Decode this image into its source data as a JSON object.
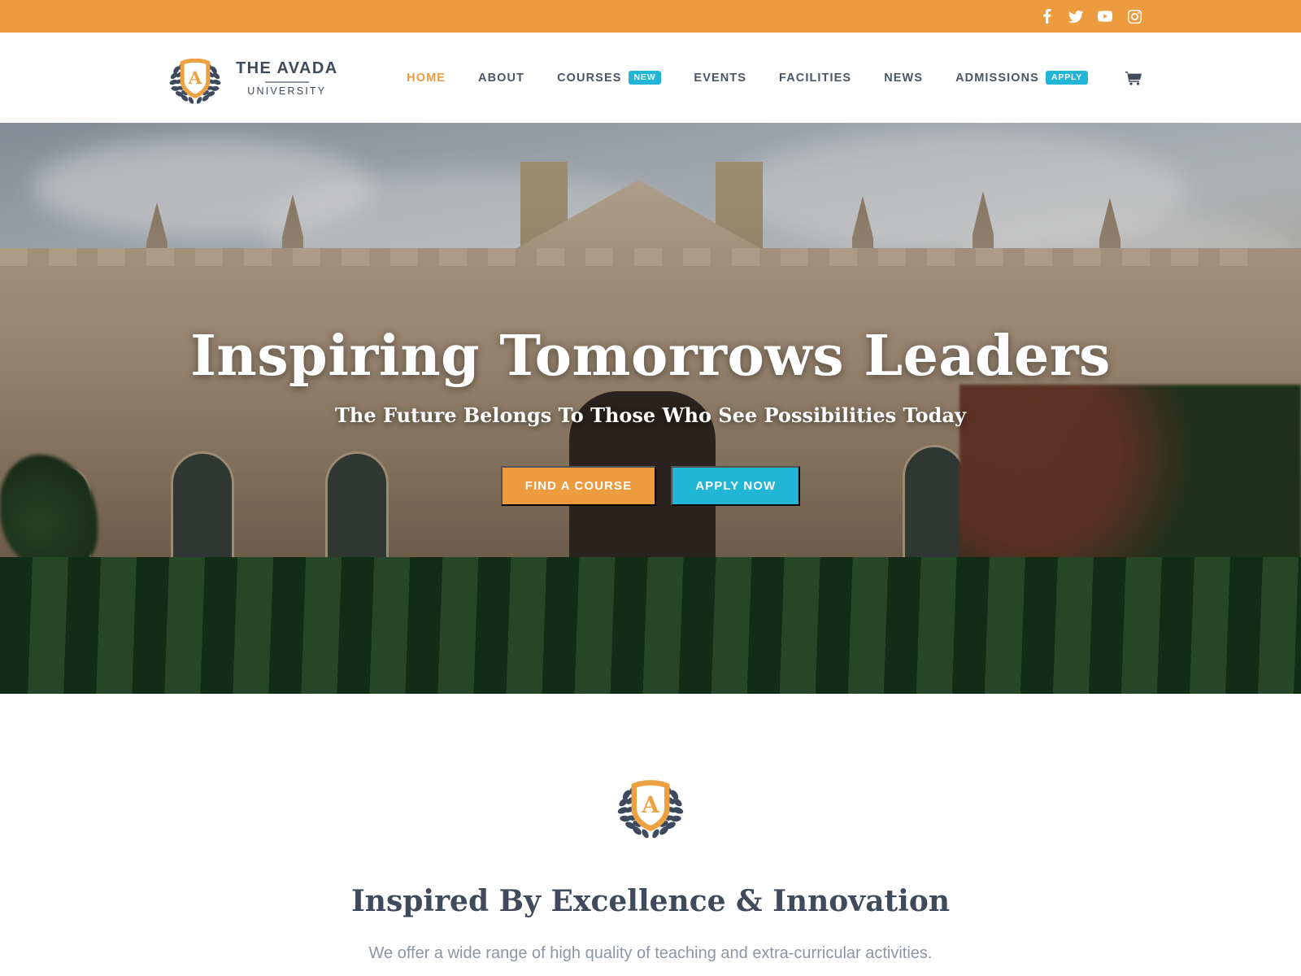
{
  "topbar": {
    "background": "#ed9b3f",
    "social": [
      {
        "name": "facebook-icon",
        "label": "Facebook"
      },
      {
        "name": "twitter-icon",
        "label": "Twitter"
      },
      {
        "name": "youtube-icon",
        "label": "YouTube"
      },
      {
        "name": "instagram-icon",
        "label": "Instagram"
      }
    ]
  },
  "header": {
    "logo": {
      "title": "THE AVADA",
      "subtitle": "UNIVERSITY",
      "mark": "laurel-shield-a-emblem"
    },
    "nav": [
      {
        "label": "HOME",
        "active": true,
        "badge": null
      },
      {
        "label": "ABOUT",
        "active": false,
        "badge": null
      },
      {
        "label": "COURSES",
        "active": false,
        "badge": "NEW"
      },
      {
        "label": "EVENTS",
        "active": false,
        "badge": null
      },
      {
        "label": "FACILITIES",
        "active": false,
        "badge": null
      },
      {
        "label": "NEWS",
        "active": false,
        "badge": null
      },
      {
        "label": "ADMISSIONS",
        "active": false,
        "badge": "APPLY"
      }
    ],
    "cart": {
      "name": "shopping-cart-icon"
    }
  },
  "hero": {
    "title": "Inspiring Tomorrows Leaders",
    "subtitle": "The Future Belongs To Those Who See Possibilities Today",
    "buttons": [
      {
        "label": "FIND A COURSE",
        "color": "#ed9b3f"
      },
      {
        "label": "APPLY NOW",
        "color": "#21b6d6"
      }
    ],
    "image_alt": "gothic-university-building-with-striped-lawn"
  },
  "intro": {
    "mark": "laurel-shield-a-emblem",
    "title": "Inspired By Excellence & Innovation",
    "text": "We offer a wide range of high quality of teaching and extra-curricular activities."
  },
  "colors": {
    "accent_orange": "#ed9b3f",
    "accent_cyan": "#21b6d6",
    "navy": "#3f4a5a",
    "muted": "#8c96a4"
  }
}
